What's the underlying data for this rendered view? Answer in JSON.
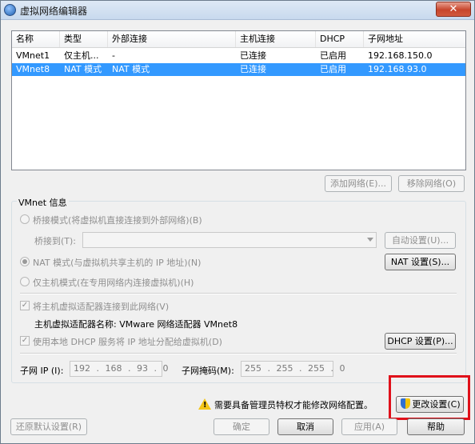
{
  "window": {
    "title": "虚拟网络编辑器",
    "close_label": "✕"
  },
  "table": {
    "columns": [
      "名称",
      "类型",
      "外部连接",
      "主机连接",
      "DHCP",
      "子网地址"
    ],
    "rows": [
      [
        "VMnet1",
        "仅主机...",
        "-",
        "已连接",
        "已启用",
        "192.168.150.0"
      ],
      [
        "VMnet8",
        "NAT 模式",
        "NAT 模式",
        "已连接",
        "已启用",
        "192.168.93.0"
      ]
    ],
    "selected_row": 1
  },
  "list_buttons": {
    "add_network": "添加网络(E)...",
    "remove_network": "移除网络(O)"
  },
  "vmnet_info": {
    "legend": "VMnet 信息",
    "bridged_mode": "桥接模式(将虚拟机直接连接到外部网络)(B)",
    "bridged_to_label": "桥接到(T):",
    "bridged_to_value": "",
    "auto_settings": "自动设置(U)...",
    "nat_mode": "NAT 模式(与虚拟机共享主机的 IP 地址)(N)",
    "nat_settings": "NAT 设置(S)...",
    "host_only_mode": "仅主机模式(在专用网络内连接虚拟机)(H)",
    "selected_mode": "nat",
    "connect_host_adapter": "将主机虚拟适配器连接到此网络(V)",
    "host_adapter_name_label": "主机虚拟适配器名称: VMware 网络适配器 VMnet8",
    "use_local_dhcp": "使用本地 DHCP 服务将 IP 地址分配给虚拟机(D)",
    "dhcp_settings": "DHCP 设置(P)...",
    "subnet_ip_label": "子网 IP (I):",
    "subnet_ip_value": "192 . 168 . 93 . 0",
    "subnet_mask_label": "子网掩码(M):",
    "subnet_mask_value": "255 . 255 . 255 . 0"
  },
  "footer": {
    "admin_warning": "需要具备管理员特权才能修改网络配置。",
    "change_settings": "更改设置(C)",
    "restore_defaults": "还原默认设置(R)",
    "ok": "确定",
    "cancel": "取消",
    "apply": "应用(A)",
    "help": "帮助"
  },
  "colors": {
    "selection": "#3399ff",
    "highlight_box": "#e0101a",
    "warning": "#f3c518"
  }
}
